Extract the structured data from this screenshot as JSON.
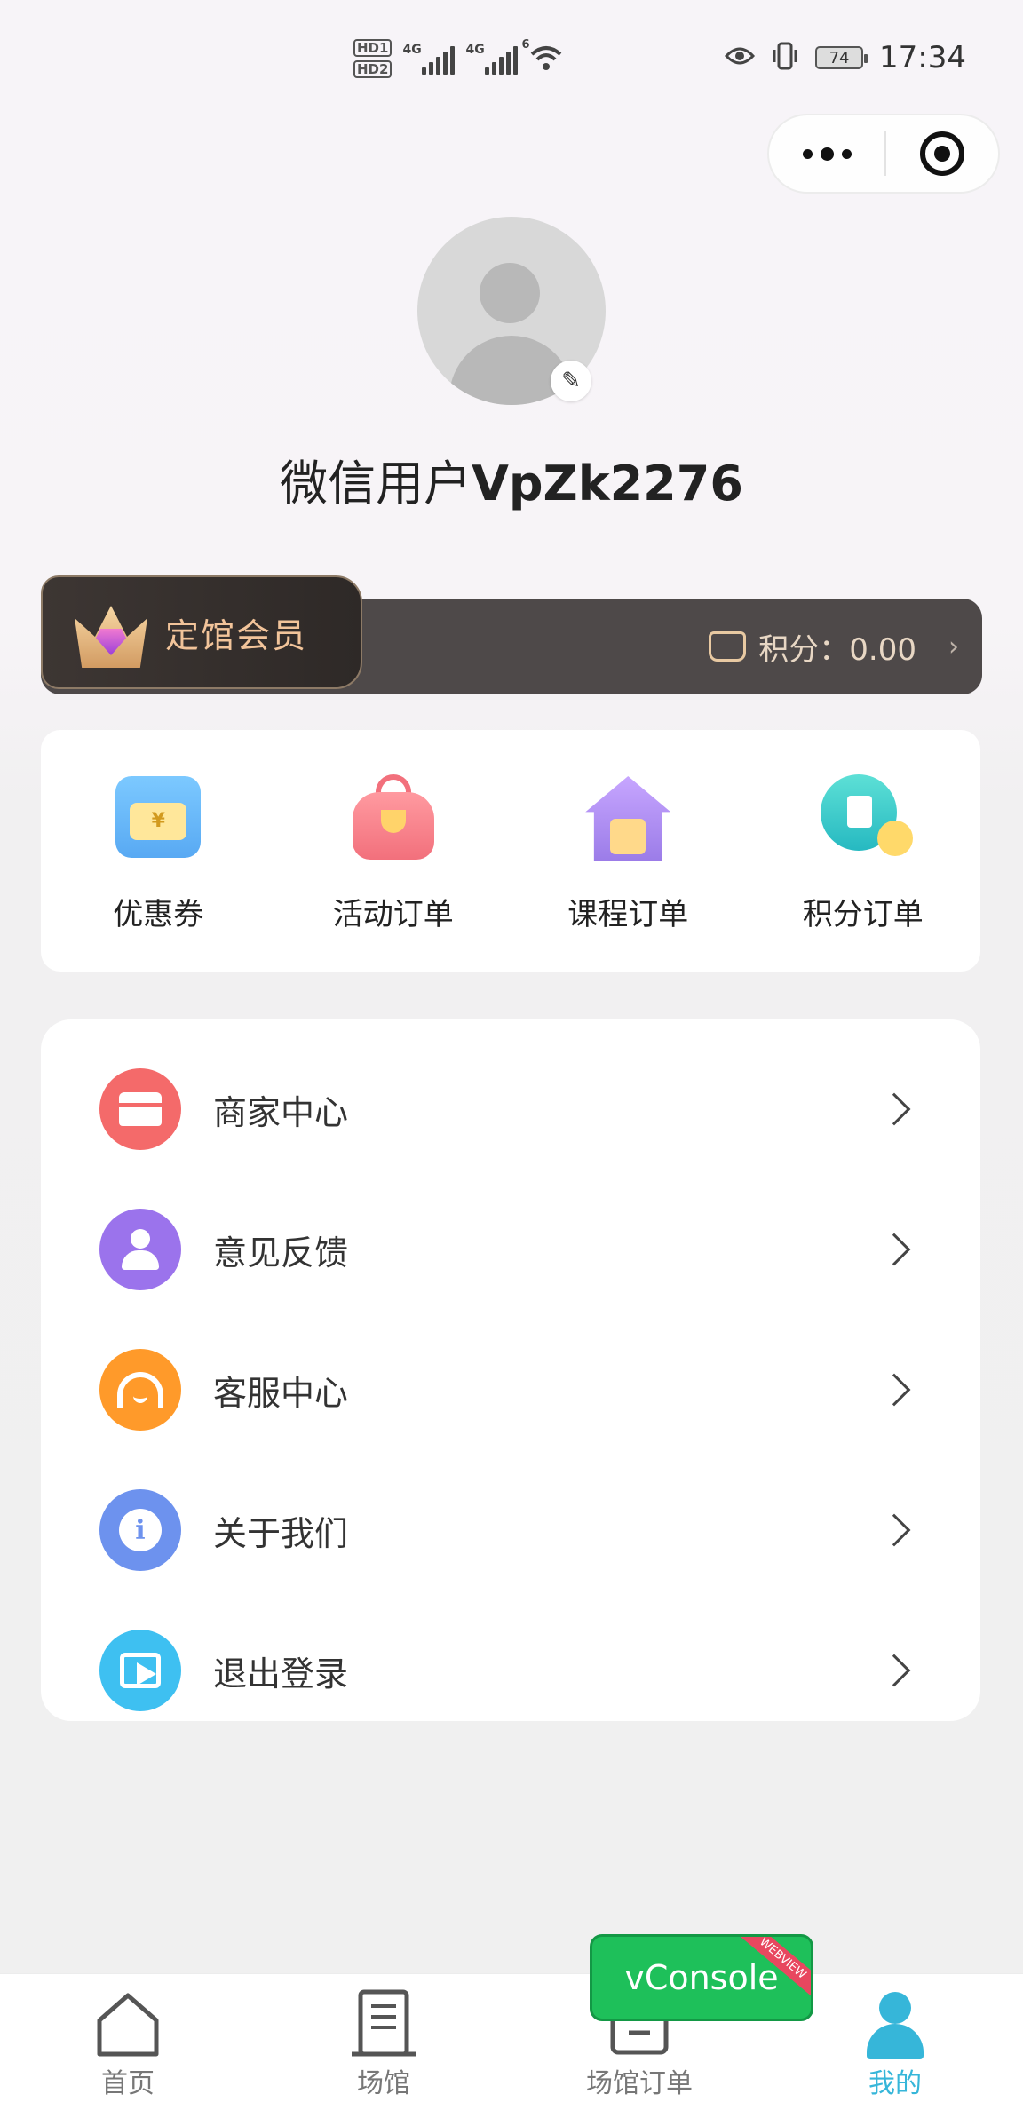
{
  "status_bar": {
    "hd1": "HD1",
    "hd2": "HD2",
    "net1": "4G",
    "net2": "4G",
    "wifi": "6",
    "battery": "74",
    "time": "17:34"
  },
  "profile": {
    "name_prefix": "微信用户",
    "name_id": "VpZk2276"
  },
  "member": {
    "title": "定馆会员",
    "points_label": "积分：",
    "points_value": "0.00"
  },
  "quick_actions": [
    {
      "label": "优惠券",
      "icon": "coupon-icon"
    },
    {
      "label": "活动订单",
      "icon": "activity-bag-icon"
    },
    {
      "label": "课程订单",
      "icon": "course-house-icon"
    },
    {
      "label": "积分订单",
      "icon": "points-order-icon"
    }
  ],
  "menu": [
    {
      "label": "商家中心",
      "icon": "shop-icon",
      "color": "#f46a6a"
    },
    {
      "label": "意见反馈",
      "icon": "user-feedback-icon",
      "color": "#9b73ec"
    },
    {
      "label": "客服中心",
      "icon": "headset-icon",
      "color": "#ff9a2a"
    },
    {
      "label": "关于我们",
      "icon": "info-icon",
      "color": "#6d92ee"
    },
    {
      "label": "退出登录",
      "icon": "logout-icon",
      "color": "#3ec0f1"
    }
  ],
  "tabs": [
    {
      "label": "首页",
      "icon": "home-icon"
    },
    {
      "label": "场馆",
      "icon": "venue-icon"
    },
    {
      "label": "场馆订单",
      "icon": "order-icon"
    },
    {
      "label": "我的",
      "icon": "profile-icon",
      "active": true
    }
  ],
  "vconsole": {
    "label": "vConsole",
    "ribbon": "WEBVIEW"
  },
  "colors": {
    "accent": "#36b6d9",
    "member_bar": "#4e4949",
    "member_gold": "#f2c49a"
  }
}
